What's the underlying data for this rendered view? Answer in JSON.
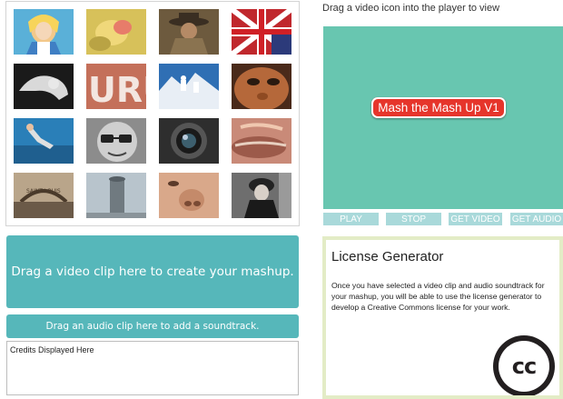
{
  "thumbnails": [
    {
      "icon": "alice-icon"
    },
    {
      "icon": "flower-icon"
    },
    {
      "icon": "detective-icon"
    },
    {
      "icon": "flag-icon"
    },
    {
      "icon": "dancer-icon"
    },
    {
      "icon": "title-letters-icon"
    },
    {
      "icon": "mountain-climber-icon"
    },
    {
      "icon": "face-closeup-icon"
    },
    {
      "icon": "diver-icon"
    },
    {
      "icon": "glasses-man-icon"
    },
    {
      "icon": "lens-icon"
    },
    {
      "icon": "mouth-closeup-icon"
    },
    {
      "icon": "arch-city-icon"
    },
    {
      "icon": "tower-icon"
    },
    {
      "icon": "nose-icon"
    },
    {
      "icon": "woman-portrait-icon"
    }
  ],
  "video_drop": {
    "label": "Drag a video clip here to create your mashup."
  },
  "audio_drop": {
    "label": "Drag an audio clip here to add a soundtrack."
  },
  "credits": {
    "placeholder": "Credits Displayed Here"
  },
  "player": {
    "instruction": "Drag a video icon into the player to view",
    "title": "Mash the Mash Up V1",
    "controls": {
      "play": "PLAY",
      "stop": "STOP",
      "get_video": "GET VIDEO",
      "get_audio": "GET AUDIO"
    }
  },
  "license": {
    "title": "License Generator",
    "text": "Once you have selected a video clip and audio soundtrack for your mashup, you will be able to use the license generator to develop a Creative Commons license for your work.",
    "logo": "cc"
  },
  "colors": {
    "teal": "#56b7ba",
    "player_bg": "#68c6b0",
    "badge_red": "#e6352b",
    "control_bg": "#a9d9da",
    "license_border": "#e3ecc6"
  }
}
